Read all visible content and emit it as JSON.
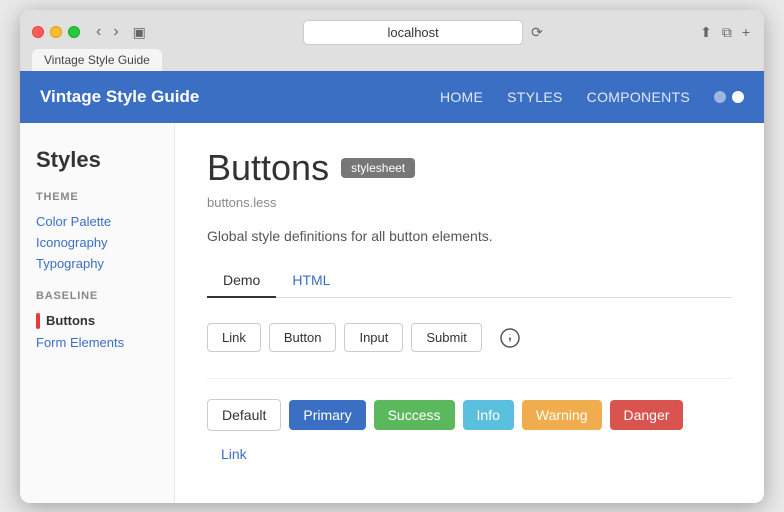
{
  "browser": {
    "url": "localhost",
    "tab_label": "Vintage Style Guide"
  },
  "nav": {
    "brand": "Vintage Style Guide",
    "links": [
      "HOME",
      "STYLES",
      "COMPONENTS"
    ],
    "dots": [
      {
        "active": false
      },
      {
        "active": true
      }
    ]
  },
  "sidebar": {
    "title": "Styles",
    "theme_section": "THEME",
    "theme_links": [
      "Color Palette",
      "Iconography",
      "Typography"
    ],
    "baseline_section": "BASELINE",
    "active_item": "Buttons",
    "baseline_links": [
      "Form Elements"
    ]
  },
  "main": {
    "title": "Buttons",
    "badge": "stylesheet",
    "subtitle": "buttons.less",
    "description": "Global style definitions for all button elements.",
    "tabs": [
      "Demo",
      "HTML"
    ],
    "active_tab": "Demo",
    "outline_buttons": [
      "Link",
      "Button",
      "Input",
      "Submit"
    ],
    "variant_buttons": [
      "Default",
      "Primary",
      "Success",
      "Info",
      "Warning",
      "Danger",
      "Link"
    ]
  }
}
